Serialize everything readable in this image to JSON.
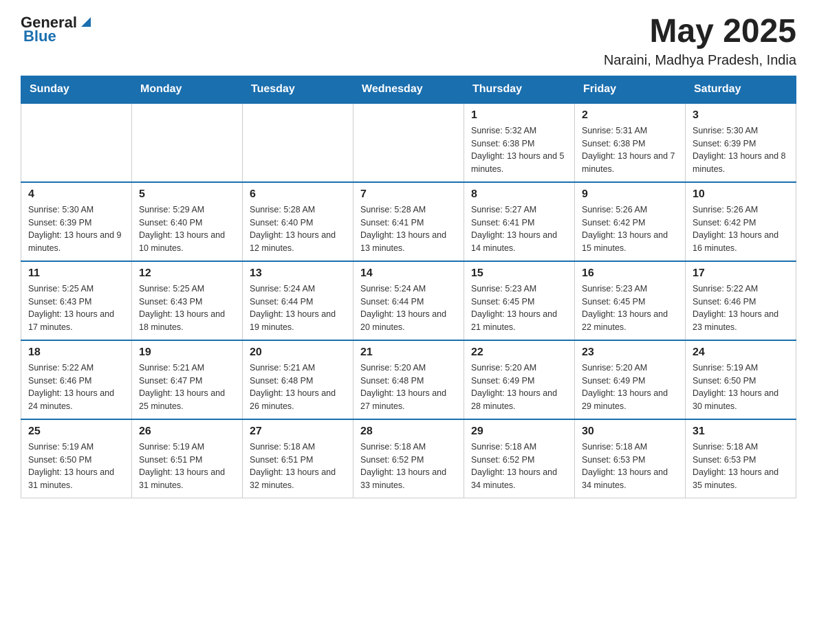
{
  "header": {
    "logo": {
      "general": "General",
      "blue": "Blue"
    },
    "month_year": "May 2025",
    "location": "Naraini, Madhya Pradesh, India"
  },
  "weekdays": [
    "Sunday",
    "Monday",
    "Tuesday",
    "Wednesday",
    "Thursday",
    "Friday",
    "Saturday"
  ],
  "weeks": [
    [
      {
        "day": "",
        "info": ""
      },
      {
        "day": "",
        "info": ""
      },
      {
        "day": "",
        "info": ""
      },
      {
        "day": "",
        "info": ""
      },
      {
        "day": "1",
        "info": "Sunrise: 5:32 AM\nSunset: 6:38 PM\nDaylight: 13 hours and 5 minutes."
      },
      {
        "day": "2",
        "info": "Sunrise: 5:31 AM\nSunset: 6:38 PM\nDaylight: 13 hours and 7 minutes."
      },
      {
        "day": "3",
        "info": "Sunrise: 5:30 AM\nSunset: 6:39 PM\nDaylight: 13 hours and 8 minutes."
      }
    ],
    [
      {
        "day": "4",
        "info": "Sunrise: 5:30 AM\nSunset: 6:39 PM\nDaylight: 13 hours and 9 minutes."
      },
      {
        "day": "5",
        "info": "Sunrise: 5:29 AM\nSunset: 6:40 PM\nDaylight: 13 hours and 10 minutes."
      },
      {
        "day": "6",
        "info": "Sunrise: 5:28 AM\nSunset: 6:40 PM\nDaylight: 13 hours and 12 minutes."
      },
      {
        "day": "7",
        "info": "Sunrise: 5:28 AM\nSunset: 6:41 PM\nDaylight: 13 hours and 13 minutes."
      },
      {
        "day": "8",
        "info": "Sunrise: 5:27 AM\nSunset: 6:41 PM\nDaylight: 13 hours and 14 minutes."
      },
      {
        "day": "9",
        "info": "Sunrise: 5:26 AM\nSunset: 6:42 PM\nDaylight: 13 hours and 15 minutes."
      },
      {
        "day": "10",
        "info": "Sunrise: 5:26 AM\nSunset: 6:42 PM\nDaylight: 13 hours and 16 minutes."
      }
    ],
    [
      {
        "day": "11",
        "info": "Sunrise: 5:25 AM\nSunset: 6:43 PM\nDaylight: 13 hours and 17 minutes."
      },
      {
        "day": "12",
        "info": "Sunrise: 5:25 AM\nSunset: 6:43 PM\nDaylight: 13 hours and 18 minutes."
      },
      {
        "day": "13",
        "info": "Sunrise: 5:24 AM\nSunset: 6:44 PM\nDaylight: 13 hours and 19 minutes."
      },
      {
        "day": "14",
        "info": "Sunrise: 5:24 AM\nSunset: 6:44 PM\nDaylight: 13 hours and 20 minutes."
      },
      {
        "day": "15",
        "info": "Sunrise: 5:23 AM\nSunset: 6:45 PM\nDaylight: 13 hours and 21 minutes."
      },
      {
        "day": "16",
        "info": "Sunrise: 5:23 AM\nSunset: 6:45 PM\nDaylight: 13 hours and 22 minutes."
      },
      {
        "day": "17",
        "info": "Sunrise: 5:22 AM\nSunset: 6:46 PM\nDaylight: 13 hours and 23 minutes."
      }
    ],
    [
      {
        "day": "18",
        "info": "Sunrise: 5:22 AM\nSunset: 6:46 PM\nDaylight: 13 hours and 24 minutes."
      },
      {
        "day": "19",
        "info": "Sunrise: 5:21 AM\nSunset: 6:47 PM\nDaylight: 13 hours and 25 minutes."
      },
      {
        "day": "20",
        "info": "Sunrise: 5:21 AM\nSunset: 6:48 PM\nDaylight: 13 hours and 26 minutes."
      },
      {
        "day": "21",
        "info": "Sunrise: 5:20 AM\nSunset: 6:48 PM\nDaylight: 13 hours and 27 minutes."
      },
      {
        "day": "22",
        "info": "Sunrise: 5:20 AM\nSunset: 6:49 PM\nDaylight: 13 hours and 28 minutes."
      },
      {
        "day": "23",
        "info": "Sunrise: 5:20 AM\nSunset: 6:49 PM\nDaylight: 13 hours and 29 minutes."
      },
      {
        "day": "24",
        "info": "Sunrise: 5:19 AM\nSunset: 6:50 PM\nDaylight: 13 hours and 30 minutes."
      }
    ],
    [
      {
        "day": "25",
        "info": "Sunrise: 5:19 AM\nSunset: 6:50 PM\nDaylight: 13 hours and 31 minutes."
      },
      {
        "day": "26",
        "info": "Sunrise: 5:19 AM\nSunset: 6:51 PM\nDaylight: 13 hours and 31 minutes."
      },
      {
        "day": "27",
        "info": "Sunrise: 5:18 AM\nSunset: 6:51 PM\nDaylight: 13 hours and 32 minutes."
      },
      {
        "day": "28",
        "info": "Sunrise: 5:18 AM\nSunset: 6:52 PM\nDaylight: 13 hours and 33 minutes."
      },
      {
        "day": "29",
        "info": "Sunrise: 5:18 AM\nSunset: 6:52 PM\nDaylight: 13 hours and 34 minutes."
      },
      {
        "day": "30",
        "info": "Sunrise: 5:18 AM\nSunset: 6:53 PM\nDaylight: 13 hours and 34 minutes."
      },
      {
        "day": "31",
        "info": "Sunrise: 5:18 AM\nSunset: 6:53 PM\nDaylight: 13 hours and 35 minutes."
      }
    ]
  ]
}
